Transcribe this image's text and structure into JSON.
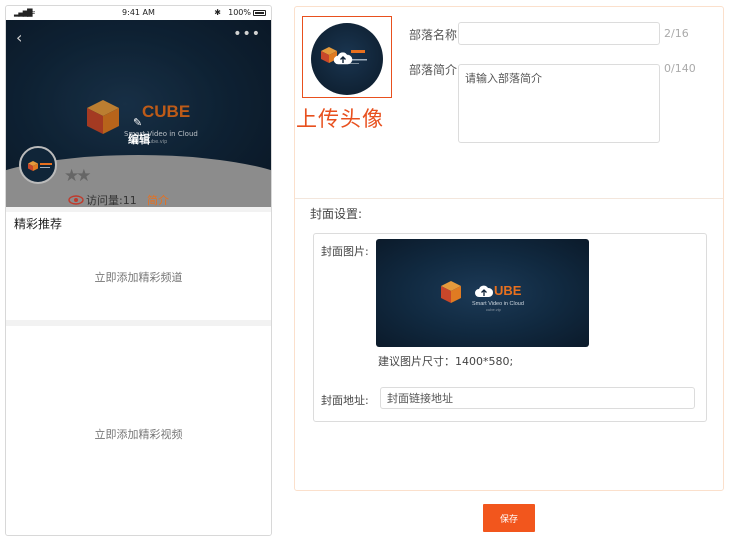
{
  "status_bar": {
    "signal": "▂▄▆█",
    "carrier": "≈",
    "time": "9:41 AM",
    "bluetooth": "✱",
    "battery": "100%"
  },
  "preview": {
    "back": "‹",
    "more": "•••",
    "logo_text": "CUBE",
    "logo_subtitle": "Smart Video in Cloud",
    "logo_url": "cube.vip",
    "edit_label": "编辑",
    "stars": "★★",
    "visits": "访问量:11",
    "intro_link": "简介",
    "channel_section_title": "精彩推荐",
    "channel_hint": "立即添加精彩频道",
    "video_hint": "立即添加精彩视频"
  },
  "form": {
    "upload_caption": "上传头像",
    "name_label": "部落名称:",
    "name_value": "",
    "name_count": "2/16",
    "intro_label": "部落简介:",
    "intro_placeholder": "请输入部落简介",
    "intro_count": "0/140",
    "cover_settings": "封面设置:",
    "cover_image_label": "封面图片:",
    "cover_size_hint": "建议图片尺寸：1400*580;",
    "cover_url_label": "封面地址:",
    "cover_url_placeholder": "封面链接地址",
    "save": "保存"
  },
  "colors": {
    "accent": "#f2561d",
    "highlight_border": "#e8501e",
    "brand_orange": "#e8701e"
  }
}
